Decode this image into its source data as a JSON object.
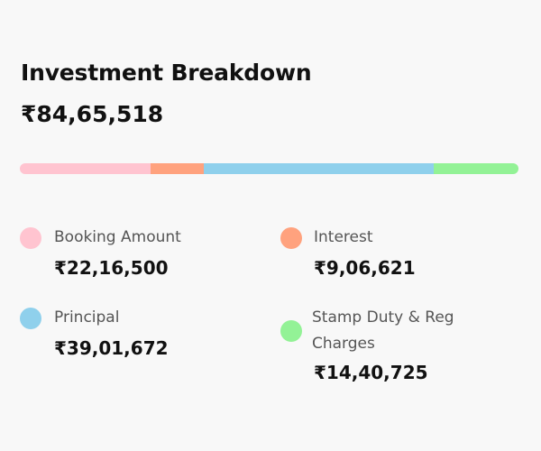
{
  "title": "Investment Breakdown",
  "total": "₹84,65,518",
  "colors": {
    "booking": "#ffc4d0",
    "interest": "#ffa27e",
    "principal": "#8fd0ec",
    "stamp": "#93f296"
  },
  "breakdown": [
    {
      "key": "booking",
      "label": "Booking Amount",
      "value": "₹22,16,500",
      "amount": 2216500
    },
    {
      "key": "interest",
      "label": "Interest",
      "value": "₹9,06,621",
      "amount": 906621
    },
    {
      "key": "principal",
      "label": "Principal",
      "value": "₹39,01,672",
      "amount": 3901672
    },
    {
      "key": "stamp",
      "label": "Stamp Duty & Reg Charges",
      "value": "₹14,40,725",
      "amount": 1440725
    }
  ]
}
